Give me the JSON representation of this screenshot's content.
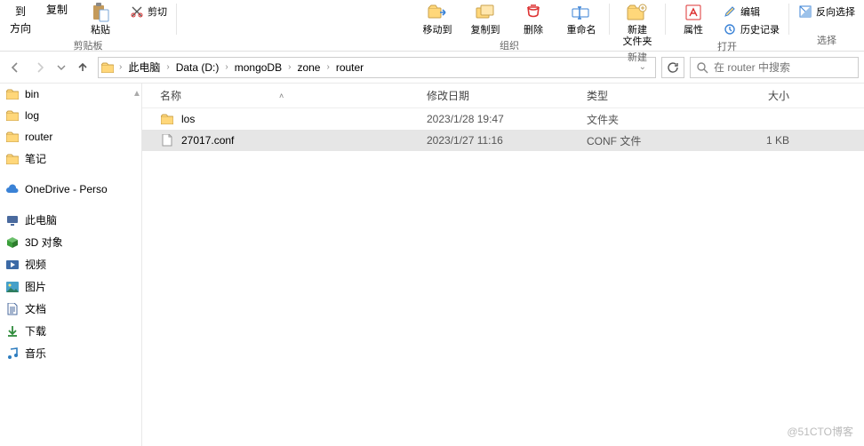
{
  "ribbon": {
    "groups": {
      "clipboard": {
        "label": "剪贴板",
        "copyto": "复制",
        "goto": "到",
        "direction": "方向",
        "paste": "粘贴",
        "cut": "剪切"
      },
      "organize": {
        "label": "组织",
        "moveTo": "移动到",
        "copyTo": "复制到",
        "delete": "删除",
        "rename": "重命名"
      },
      "new": {
        "label": "新建",
        "newFolder": "新建\n文件夹"
      },
      "open": {
        "label": "打开",
        "properties": "属性",
        "edit": "编辑",
        "history": "历史记录"
      },
      "select": {
        "label": "选择",
        "invert": "反向选择"
      }
    }
  },
  "breadcrumb": {
    "items": [
      "此电脑",
      "Data (D:)",
      "mongoDB",
      "zone",
      "router"
    ]
  },
  "search": {
    "placeholder": "在 router 中搜索"
  },
  "nav": {
    "items": [
      {
        "icon": "folder",
        "label": "bin"
      },
      {
        "icon": "folder",
        "label": "log"
      },
      {
        "icon": "folder",
        "label": "router"
      },
      {
        "icon": "folder",
        "label": "笔记"
      },
      {
        "icon": "cloud",
        "label": "OneDrive - Perso",
        "spaced": true
      },
      {
        "icon": "pc",
        "label": "此电脑",
        "spaced": true
      },
      {
        "icon": "cube",
        "label": "3D 对象"
      },
      {
        "icon": "video",
        "label": "视频"
      },
      {
        "icon": "picture",
        "label": "图片"
      },
      {
        "icon": "doc",
        "label": "文档"
      },
      {
        "icon": "download",
        "label": "下载"
      },
      {
        "icon": "music",
        "label": "音乐"
      }
    ]
  },
  "columns": {
    "name": "名称",
    "modified": "修改日期",
    "type": "类型",
    "size": "大小"
  },
  "files": [
    {
      "icon": "folder",
      "name": "los",
      "modified": "2023/1/28 19:47",
      "type": "文件夹",
      "size": "",
      "selected": false
    },
    {
      "icon": "file",
      "name": "27017.conf",
      "modified": "2023/1/27 11:16",
      "type": "CONF 文件",
      "size": "1 KB",
      "selected": true
    }
  ],
  "watermark": "@51CTO博客"
}
